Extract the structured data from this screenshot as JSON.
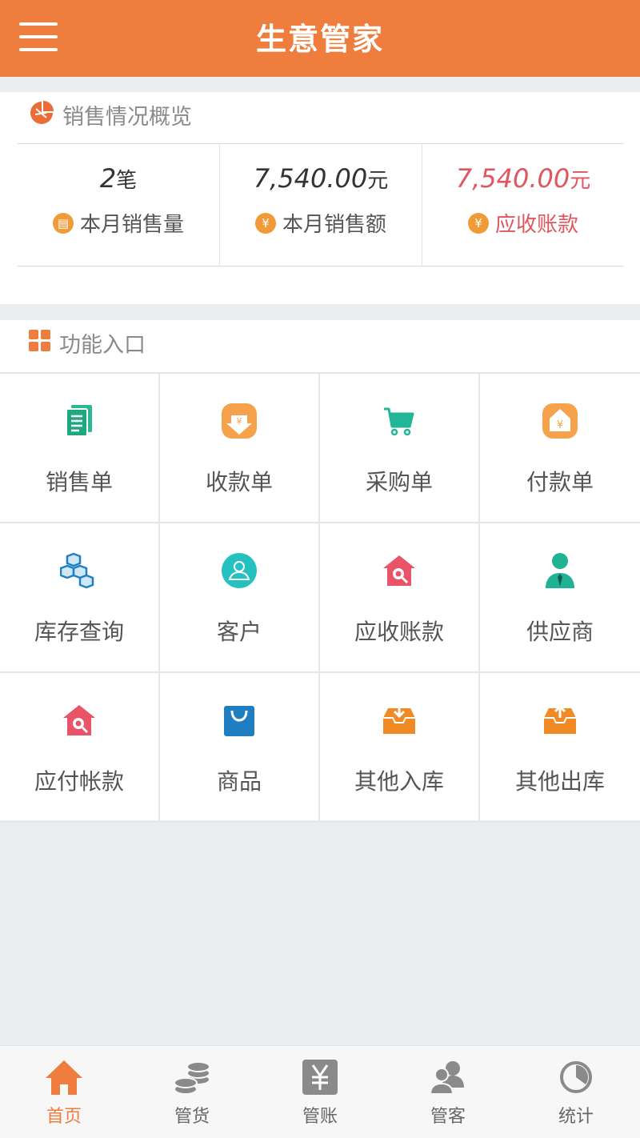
{
  "header": {
    "title": "生意管家",
    "menu_icon": "hamburger-menu-icon"
  },
  "overview": {
    "title": "销售情况概览",
    "icon": "pie-chart-icon",
    "stats": [
      {
        "value": "2",
        "unit": "笔",
        "label": "本月销售量",
        "icon": "receipt-coin-icon",
        "highlight": false
      },
      {
        "value": "7,540.00",
        "unit": "元",
        "label": "本月销售额",
        "icon": "yen-coin-icon",
        "highlight": false
      },
      {
        "value": "7,540.00",
        "unit": "元",
        "label": "应收账款",
        "icon": "yen-coin-icon",
        "highlight": true
      }
    ]
  },
  "functions": {
    "title": "功能入口",
    "icon": "grid-icon",
    "items": [
      {
        "label": "销售单",
        "icon": "document-icon"
      },
      {
        "label": "收款单",
        "icon": "receive-money-icon"
      },
      {
        "label": "采购单",
        "icon": "cart-icon"
      },
      {
        "label": "付款单",
        "icon": "pay-money-icon"
      },
      {
        "label": "库存查询",
        "icon": "boxes-icon"
      },
      {
        "label": "客户",
        "icon": "customer-icon"
      },
      {
        "label": "应收账款",
        "icon": "house-search-icon"
      },
      {
        "label": "供应商",
        "icon": "supplier-icon"
      },
      {
        "label": "应付帐款",
        "icon": "house-search-icon"
      },
      {
        "label": "商品",
        "icon": "shopping-bag-icon"
      },
      {
        "label": "其他入库",
        "icon": "inbox-in-icon"
      },
      {
        "label": "其他出库",
        "icon": "inbox-out-icon"
      }
    ]
  },
  "tabbar": [
    {
      "label": "首页",
      "icon": "home-icon",
      "active": true
    },
    {
      "label": "管货",
      "icon": "coins-icon",
      "active": false
    },
    {
      "label": "管账",
      "icon": "yen-box-icon",
      "active": false
    },
    {
      "label": "管客",
      "icon": "users-icon",
      "active": false
    },
    {
      "label": "统计",
      "icon": "pie-icon",
      "active": false
    }
  ],
  "colors": {
    "brand": "#ee7d3e",
    "highlight": "#e0565f",
    "coin": "#f19a38"
  }
}
